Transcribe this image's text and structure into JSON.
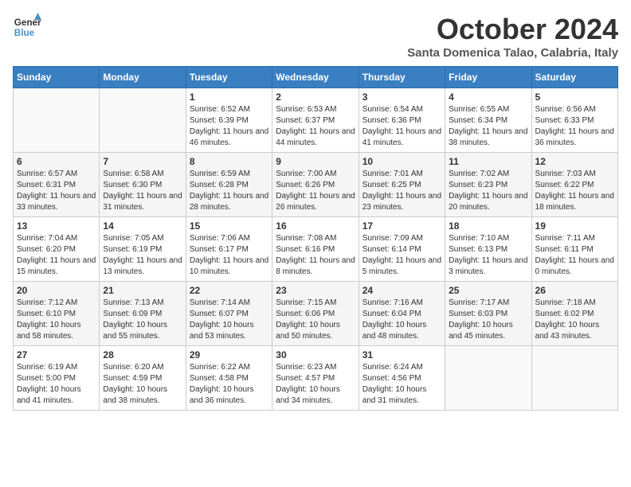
{
  "header": {
    "logo_line1": "General",
    "logo_line2": "Blue",
    "month": "October 2024",
    "location": "Santa Domenica Talao, Calabria, Italy"
  },
  "days_of_week": [
    "Sunday",
    "Monday",
    "Tuesday",
    "Wednesday",
    "Thursday",
    "Friday",
    "Saturday"
  ],
  "weeks": [
    [
      {
        "day": "",
        "detail": ""
      },
      {
        "day": "",
        "detail": ""
      },
      {
        "day": "1",
        "detail": "Sunrise: 6:52 AM\nSunset: 6:39 PM\nDaylight: 11 hours and 46 minutes."
      },
      {
        "day": "2",
        "detail": "Sunrise: 6:53 AM\nSunset: 6:37 PM\nDaylight: 11 hours and 44 minutes."
      },
      {
        "day": "3",
        "detail": "Sunrise: 6:54 AM\nSunset: 6:36 PM\nDaylight: 11 hours and 41 minutes."
      },
      {
        "day": "4",
        "detail": "Sunrise: 6:55 AM\nSunset: 6:34 PM\nDaylight: 11 hours and 38 minutes."
      },
      {
        "day": "5",
        "detail": "Sunrise: 6:56 AM\nSunset: 6:33 PM\nDaylight: 11 hours and 36 minutes."
      }
    ],
    [
      {
        "day": "6",
        "detail": "Sunrise: 6:57 AM\nSunset: 6:31 PM\nDaylight: 11 hours and 33 minutes."
      },
      {
        "day": "7",
        "detail": "Sunrise: 6:58 AM\nSunset: 6:30 PM\nDaylight: 11 hours and 31 minutes."
      },
      {
        "day": "8",
        "detail": "Sunrise: 6:59 AM\nSunset: 6:28 PM\nDaylight: 11 hours and 28 minutes."
      },
      {
        "day": "9",
        "detail": "Sunrise: 7:00 AM\nSunset: 6:26 PM\nDaylight: 11 hours and 26 minutes."
      },
      {
        "day": "10",
        "detail": "Sunrise: 7:01 AM\nSunset: 6:25 PM\nDaylight: 11 hours and 23 minutes."
      },
      {
        "day": "11",
        "detail": "Sunrise: 7:02 AM\nSunset: 6:23 PM\nDaylight: 11 hours and 20 minutes."
      },
      {
        "day": "12",
        "detail": "Sunrise: 7:03 AM\nSunset: 6:22 PM\nDaylight: 11 hours and 18 minutes."
      }
    ],
    [
      {
        "day": "13",
        "detail": "Sunrise: 7:04 AM\nSunset: 6:20 PM\nDaylight: 11 hours and 15 minutes."
      },
      {
        "day": "14",
        "detail": "Sunrise: 7:05 AM\nSunset: 6:19 PM\nDaylight: 11 hours and 13 minutes."
      },
      {
        "day": "15",
        "detail": "Sunrise: 7:06 AM\nSunset: 6:17 PM\nDaylight: 11 hours and 10 minutes."
      },
      {
        "day": "16",
        "detail": "Sunrise: 7:08 AM\nSunset: 6:16 PM\nDaylight: 11 hours and 8 minutes."
      },
      {
        "day": "17",
        "detail": "Sunrise: 7:09 AM\nSunset: 6:14 PM\nDaylight: 11 hours and 5 minutes."
      },
      {
        "day": "18",
        "detail": "Sunrise: 7:10 AM\nSunset: 6:13 PM\nDaylight: 11 hours and 3 minutes."
      },
      {
        "day": "19",
        "detail": "Sunrise: 7:11 AM\nSunset: 6:11 PM\nDaylight: 11 hours and 0 minutes."
      }
    ],
    [
      {
        "day": "20",
        "detail": "Sunrise: 7:12 AM\nSunset: 6:10 PM\nDaylight: 10 hours and 58 minutes."
      },
      {
        "day": "21",
        "detail": "Sunrise: 7:13 AM\nSunset: 6:09 PM\nDaylight: 10 hours and 55 minutes."
      },
      {
        "day": "22",
        "detail": "Sunrise: 7:14 AM\nSunset: 6:07 PM\nDaylight: 10 hours and 53 minutes."
      },
      {
        "day": "23",
        "detail": "Sunrise: 7:15 AM\nSunset: 6:06 PM\nDaylight: 10 hours and 50 minutes."
      },
      {
        "day": "24",
        "detail": "Sunrise: 7:16 AM\nSunset: 6:04 PM\nDaylight: 10 hours and 48 minutes."
      },
      {
        "day": "25",
        "detail": "Sunrise: 7:17 AM\nSunset: 6:03 PM\nDaylight: 10 hours and 45 minutes."
      },
      {
        "day": "26",
        "detail": "Sunrise: 7:18 AM\nSunset: 6:02 PM\nDaylight: 10 hours and 43 minutes."
      }
    ],
    [
      {
        "day": "27",
        "detail": "Sunrise: 6:19 AM\nSunset: 5:00 PM\nDaylight: 10 hours and 41 minutes."
      },
      {
        "day": "28",
        "detail": "Sunrise: 6:20 AM\nSunset: 4:59 PM\nDaylight: 10 hours and 38 minutes."
      },
      {
        "day": "29",
        "detail": "Sunrise: 6:22 AM\nSunset: 4:58 PM\nDaylight: 10 hours and 36 minutes."
      },
      {
        "day": "30",
        "detail": "Sunrise: 6:23 AM\nSunset: 4:57 PM\nDaylight: 10 hours and 34 minutes."
      },
      {
        "day": "31",
        "detail": "Sunrise: 6:24 AM\nSunset: 4:56 PM\nDaylight: 10 hours and 31 minutes."
      },
      {
        "day": "",
        "detail": ""
      },
      {
        "day": "",
        "detail": ""
      }
    ]
  ]
}
